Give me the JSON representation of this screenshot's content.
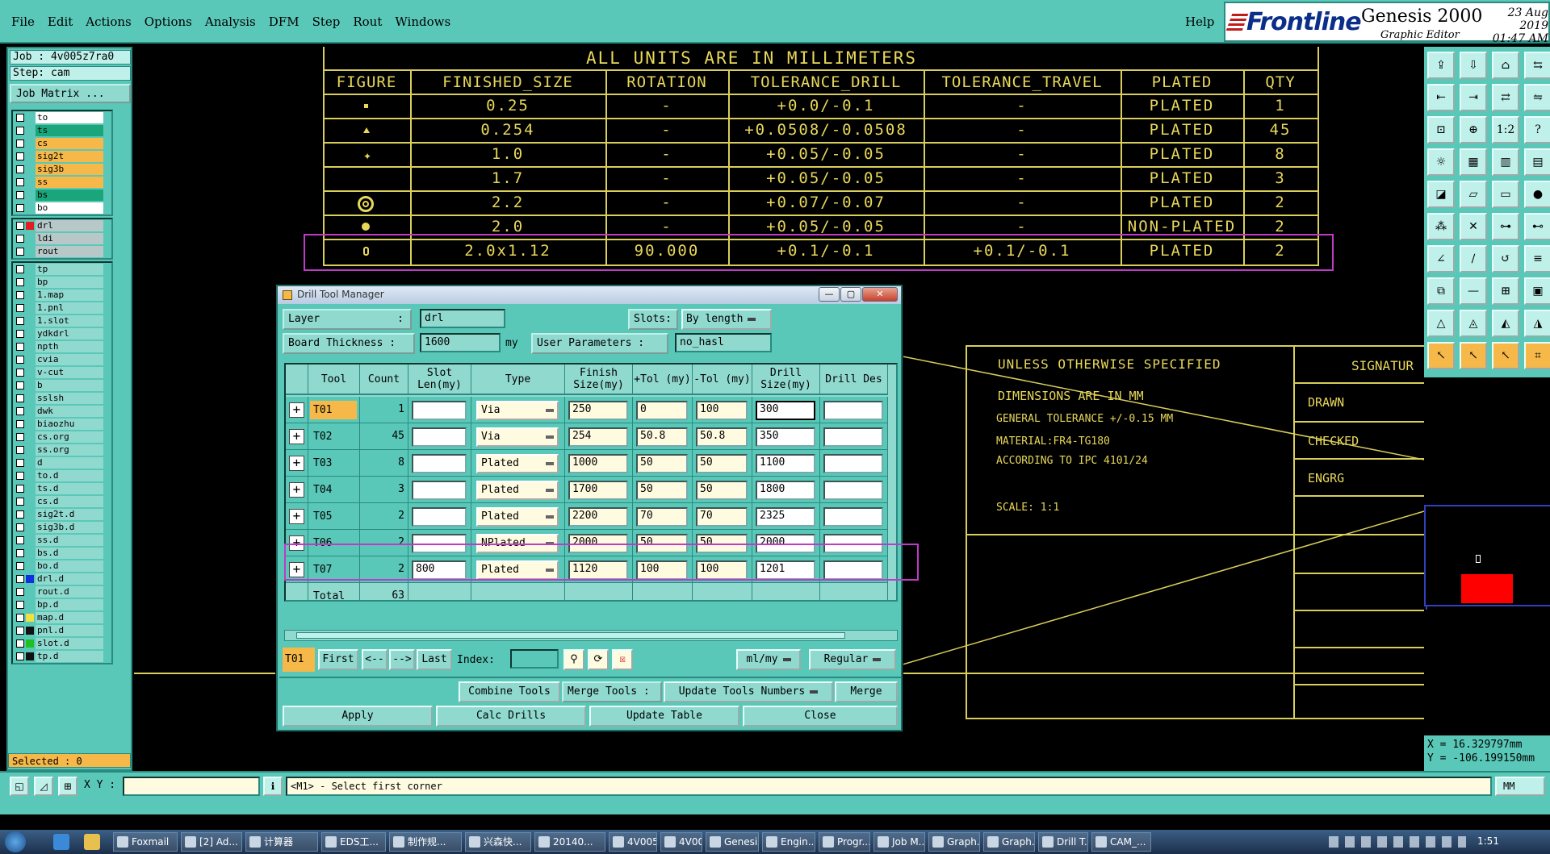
{
  "menubar": {
    "items": [
      "File",
      "Edit",
      "Actions",
      "Options",
      "Analysis",
      "DFM",
      "Step",
      "Rout",
      "Windows"
    ],
    "help": "Help"
  },
  "brand": {
    "logo": "Frontline",
    "product": "Genesis 2000",
    "subtitle": "Graphic Editor",
    "date": "23 Aug 2019",
    "time": "01:47 AM"
  },
  "left": {
    "job": "Job : 4v005z7ra0",
    "step": "Step: cam",
    "job_matrix": "Job Matrix ...",
    "selected": "Selected : 0",
    "group1": [
      {
        "name": "to",
        "color": "#ffffff",
        "swatch": ""
      },
      {
        "name": "ts",
        "color": "#1aa57a",
        "swatch": ""
      },
      {
        "name": "cs",
        "color": "#f7b84a",
        "swatch": ""
      },
      {
        "name": "sig2t",
        "color": "#f7b84a",
        "swatch": ""
      },
      {
        "name": "sig3b",
        "color": "#f7b84a",
        "swatch": ""
      },
      {
        "name": "ss",
        "color": "#f7b84a",
        "swatch": ""
      },
      {
        "name": "bs",
        "color": "#1aa57a",
        "swatch": ""
      },
      {
        "name": "bo",
        "color": "#ffffff",
        "swatch": ""
      }
    ],
    "group2": [
      {
        "name": "drl",
        "color": "#b8c8c8",
        "swatch": "#e02020"
      },
      {
        "name": "ldi",
        "color": "#b8c8c8",
        "swatch": ""
      },
      {
        "name": "rout",
        "color": "#b8c8c8",
        "swatch": ""
      }
    ],
    "group3": [
      {
        "name": "tp",
        "color": "#8fd9cf",
        "swatch": ""
      },
      {
        "name": "bp",
        "color": "#8fd9cf",
        "swatch": ""
      },
      {
        "name": "1.map",
        "color": "#8fd9cf",
        "swatch": ""
      },
      {
        "name": "1.pnl",
        "color": "#8fd9cf",
        "swatch": ""
      },
      {
        "name": "1.slot",
        "color": "#8fd9cf",
        "swatch": ""
      },
      {
        "name": "ydkdrl",
        "color": "#8fd9cf",
        "swatch": ""
      },
      {
        "name": "npth",
        "color": "#8fd9cf",
        "swatch": ""
      },
      {
        "name": "cvia",
        "color": "#8fd9cf",
        "swatch": ""
      },
      {
        "name": "v-cut",
        "color": "#8fd9cf",
        "swatch": ""
      },
      {
        "name": "b",
        "color": "#8fd9cf",
        "swatch": ""
      },
      {
        "name": "sslsh",
        "color": "#8fd9cf",
        "swatch": ""
      },
      {
        "name": "dwk",
        "color": "#8fd9cf",
        "swatch": ""
      },
      {
        "name": "biaozhu",
        "color": "#8fd9cf",
        "swatch": ""
      },
      {
        "name": "cs.org",
        "color": "#8fd9cf",
        "swatch": ""
      },
      {
        "name": "ss.org",
        "color": "#8fd9cf",
        "swatch": ""
      },
      {
        "name": "d",
        "color": "#8fd9cf",
        "swatch": ""
      },
      {
        "name": "to.d",
        "color": "#8fd9cf",
        "swatch": ""
      },
      {
        "name": "ts.d",
        "color": "#8fd9cf",
        "swatch": ""
      },
      {
        "name": "cs.d",
        "color": "#8fd9cf",
        "swatch": ""
      },
      {
        "name": "sig2t.d",
        "color": "#8fd9cf",
        "swatch": ""
      },
      {
        "name": "sig3b.d",
        "color": "#8fd9cf",
        "swatch": ""
      },
      {
        "name": "ss.d",
        "color": "#8fd9cf",
        "swatch": ""
      },
      {
        "name": "bs.d",
        "color": "#8fd9cf",
        "swatch": ""
      },
      {
        "name": "bo.d",
        "color": "#8fd9cf",
        "swatch": ""
      },
      {
        "name": "drl.d",
        "color": "#8fd9cf",
        "swatch": "#1030e0"
      },
      {
        "name": "rout.d",
        "color": "#8fd9cf",
        "swatch": ""
      },
      {
        "name": "bp.d",
        "color": "#8fd9cf",
        "swatch": ""
      },
      {
        "name": "map.d",
        "color": "#8fd9cf",
        "swatch": "#f0e040"
      },
      {
        "name": "pnl.d",
        "color": "#8fd9cf",
        "swatch": "#111111"
      },
      {
        "name": "slot.d",
        "color": "#8fd9cf",
        "swatch": "#20c020"
      },
      {
        "name": "tp.d",
        "color": "#8fd9cf",
        "swatch": "#111111"
      }
    ]
  },
  "drill_table": {
    "title": "ALL UNITS ARE IN MILLIMETERS",
    "headers": [
      "FIGURE",
      "FINISHED_SIZE",
      "ROTATION",
      "TOLERANCE_DRILL",
      "TOLERANCE_TRAVEL",
      "PLATED",
      "QTY"
    ],
    "rows": [
      [
        "0.25",
        "-",
        "+0.0/-0.1",
        "-",
        "PLATED",
        "1"
      ],
      [
        "0.254",
        "-",
        "+0.0508/-0.0508",
        "-",
        "PLATED",
        "45"
      ],
      [
        "1.0",
        "-",
        "+0.05/-0.05",
        "-",
        "PLATED",
        "8"
      ],
      [
        "1.7",
        "-",
        "+0.05/-0.05",
        "-",
        "PLATED",
        "3"
      ],
      [
        "2.2",
        "-",
        "+0.07/-0.07",
        "-",
        "PLATED",
        "2"
      ],
      [
        "2.0",
        "-",
        "+0.05/-0.05",
        "-",
        "NON-PLATED",
        "2"
      ],
      [
        "2.0x1.12",
        "90.000",
        "+0.1/-0.1",
        "+0.1/-0.1",
        "PLATED",
        "2"
      ]
    ]
  },
  "title_block": {
    "l1": "UNLESS OTHERWISE SPECIFIED",
    "l2": "DIMENSIONS ARE IN MM",
    "l3": "GENERAL TOLERANCE +/-0.15 MM",
    "l4": "MATERIAL:FR4-TG180",
    "l5": "ACCORDING TO IPC 4101/24",
    "l6": "SCALE: 1:1",
    "signature": "SIGNATUR",
    "drawn": "DRAWN",
    "checked": "CHECKED",
    "engrg": "ENGRG"
  },
  "dialog": {
    "title": "Drill Tool Manager",
    "layer_label": "Layer",
    "layer_value": "drl",
    "slots_label": "Slots:",
    "slots_value": "By length",
    "board_thickness_label": "Board Thickness :",
    "board_thickness_value": "1600",
    "board_thickness_unit": "my",
    "user_params_label": "User Parameters :",
    "user_params_value": "no_hasl",
    "columns": [
      "Tool",
      "Count",
      "Slot Len(my)",
      "Type",
      "Finish Size(my)",
      "+Tol (my)",
      "-Tol (my)",
      "Drill Size(my)",
      "Drill Des"
    ],
    "rows": [
      {
        "tool": "T01",
        "count": "1",
        "slot": "",
        "type": "Via",
        "finish": "250",
        "ptol": "0",
        "ntol": "100",
        "drill": "300",
        "des": ""
      },
      {
        "tool": "T02",
        "count": "45",
        "slot": "",
        "type": "Via",
        "finish": "254",
        "ptol": "50.8",
        "ntol": "50.8",
        "drill": "350",
        "des": ""
      },
      {
        "tool": "T03",
        "count": "8",
        "slot": "",
        "type": "Plated",
        "finish": "1000",
        "ptol": "50",
        "ntol": "50",
        "drill": "1100",
        "des": ""
      },
      {
        "tool": "T04",
        "count": "3",
        "slot": "",
        "type": "Plated",
        "finish": "1700",
        "ptol": "50",
        "ntol": "50",
        "drill": "1800",
        "des": ""
      },
      {
        "tool": "T05",
        "count": "2",
        "slot": "",
        "type": "Plated",
        "finish": "2200",
        "ptol": "70",
        "ntol": "70",
        "drill": "2325",
        "des": ""
      },
      {
        "tool": "T06",
        "count": "2",
        "slot": "",
        "type": "NPlated",
        "finish": "2000",
        "ptol": "50",
        "ntol": "50",
        "drill": "2000",
        "des": ""
      },
      {
        "tool": "T07",
        "count": "2",
        "slot": "800",
        "type": "Plated",
        "finish": "1120",
        "ptol": "100",
        "ntol": "100",
        "drill": "1201",
        "des": ""
      }
    ],
    "total_label": "Total",
    "total_value": "63",
    "nav_current": "T01",
    "nav_first": "First",
    "nav_prev": "<--",
    "nav_next": "-->",
    "nav_last": "Last",
    "index_label": "Index:",
    "units_select": "ml/my",
    "mode_select": "Regular",
    "combine_tools": "Combine Tools",
    "merge_tools": "Merge Tools :",
    "update_tools_numbers": "Update Tools Numbers",
    "merge": "Merge",
    "apply": "Apply",
    "calc_drills": "Calc Drills",
    "update_table": "Update Table",
    "close": "Close"
  },
  "coords": {
    "x": "X = 16.329797mm",
    "y": "Y = -106.199150mm"
  },
  "command": {
    "xy_label": "X Y :",
    "message": "<M1> - Select first corner",
    "units": "MM"
  },
  "taskbar": {
    "tasks": [
      "Foxmail",
      "[2] Ad...",
      "计算器",
      "EDS工...",
      "制作规...",
      "兴森快...",
      "20140...",
      "4V005...",
      "4V005...",
      "Genesis",
      "Engin...",
      "Progr...",
      "Job M...",
      "Graph...",
      "Graph...",
      "Drill T...",
      "CAM_..."
    ],
    "clock": "1:51"
  }
}
